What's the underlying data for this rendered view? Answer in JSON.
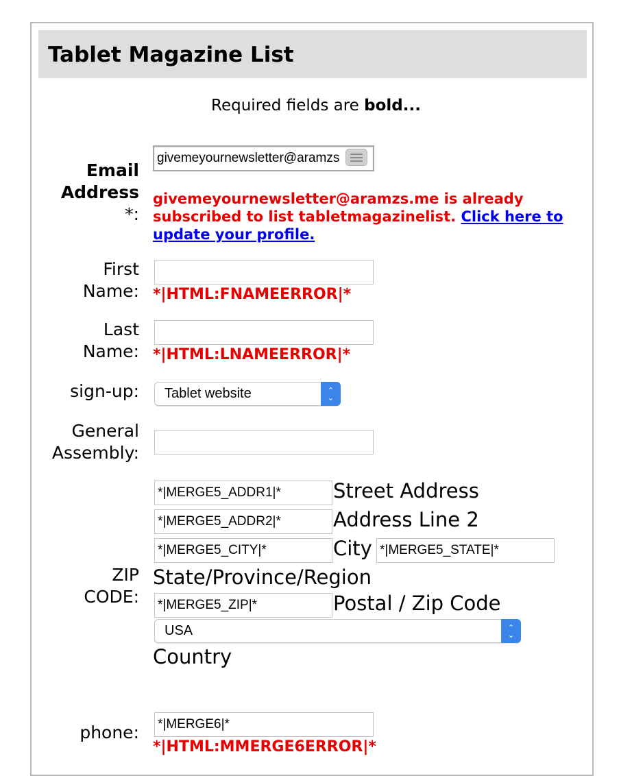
{
  "form": {
    "title": "Tablet Magazine List",
    "required_note_prefix": "Required fields are ",
    "required_note_bold": "bold..."
  },
  "email": {
    "label_line1": "Email",
    "label_line2": "Address",
    "label_line3": "*:",
    "value": "givemeyournewsletter@aramzs",
    "error_text": "givemeyournewsletter@aramzs.me is already subscribed to list tabletmagazinelist.",
    "error_link": "Click here to update your profile."
  },
  "first_name": {
    "label_line1": "First",
    "label_line2": "Name:",
    "value": "",
    "error": "*|HTML:FNAMEERROR|*"
  },
  "last_name": {
    "label_line1": "Last",
    "label_line2": "Name:",
    "value": "",
    "error": "*|HTML:LNAMEERROR|*"
  },
  "signup": {
    "label": "sign-up:",
    "selected": "Tablet website"
  },
  "general_assembly": {
    "label_line1": "General",
    "label_line2": "Assembly:",
    "value": ""
  },
  "address": {
    "label_line1": "ZIP",
    "label_line2": "CODE:",
    "addr1_value": "*|MERGE5_ADDR1|*",
    "addr1_caption": "Street Address",
    "addr2_value": "*|MERGE5_ADDR2|*",
    "addr2_caption": "Address Line 2",
    "city_value": "*|MERGE5_CITY|*",
    "city_caption": "City",
    "state_value": "*|MERGE5_STATE|*",
    "state_caption": "State/Province/Region",
    "zip_value": "*|MERGE5_ZIP|*",
    "zip_caption": "Postal / Zip Code",
    "country_selected": "USA",
    "country_caption": "Country"
  },
  "phone": {
    "label": "phone:",
    "value": "*|MERGE6|*",
    "error": "*|HTML:MMERGE6ERROR|*"
  },
  "colors": {
    "error_red": "#e60000",
    "link_blue": "#0000ee",
    "select_accent": "#3b85ea",
    "header_bg": "#dedede"
  },
  "icons": {
    "email_field_badge": "contact-card-icon",
    "select_arrows": "up-down-chevron-icon"
  }
}
